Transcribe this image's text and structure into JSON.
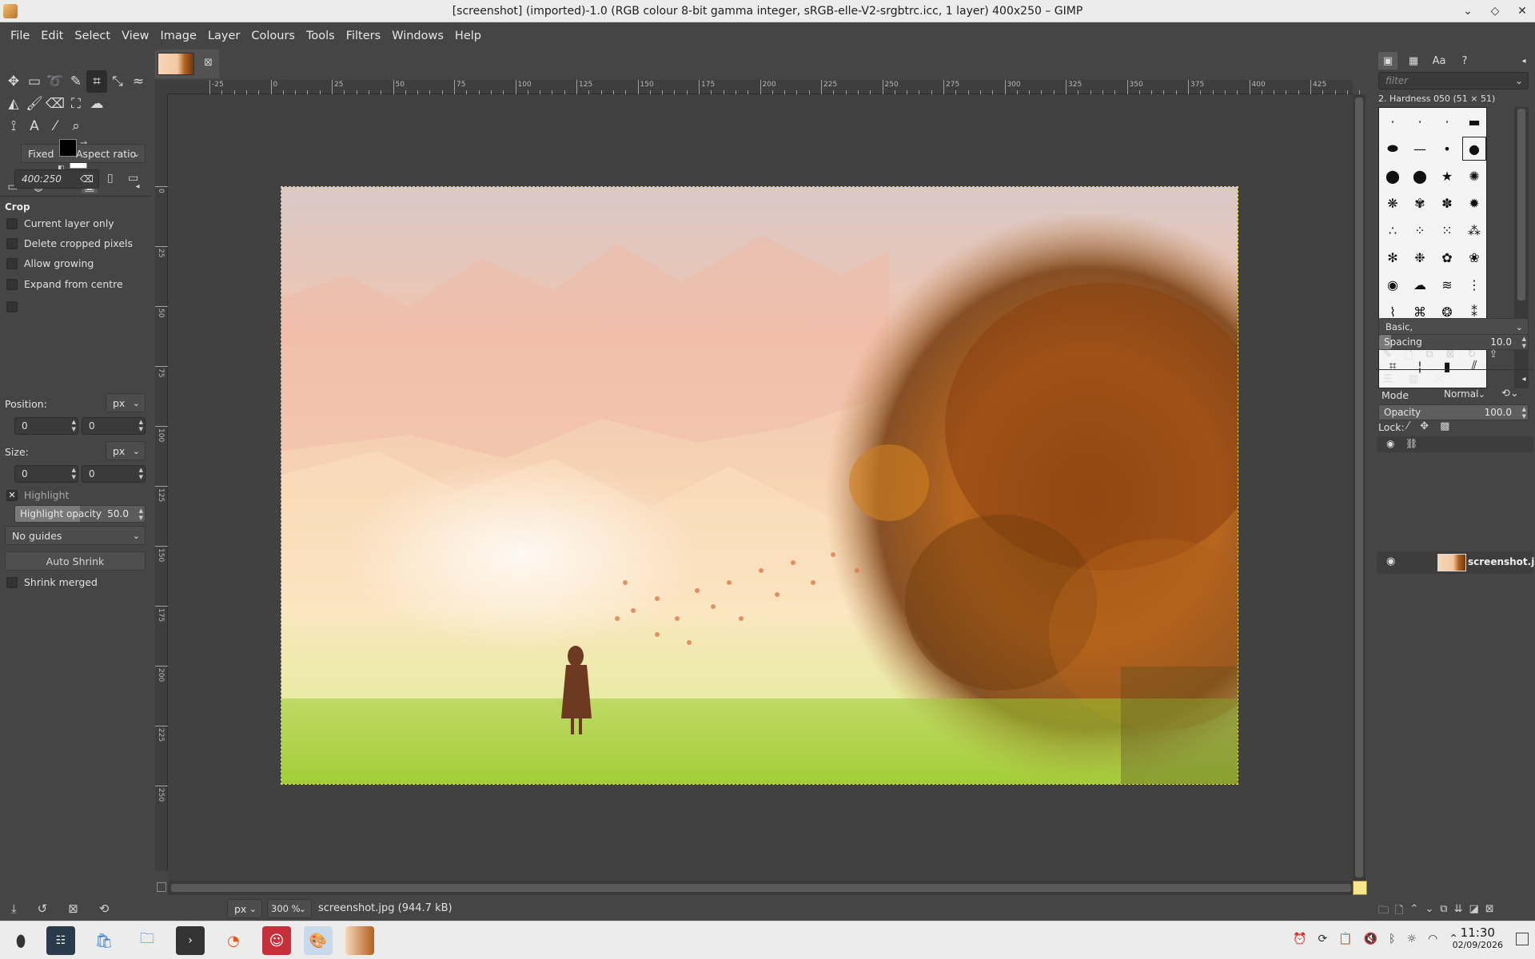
{
  "window": {
    "title": "[screenshot] (imported)-1.0 (RGB colour 8-bit gamma integer, sRGB-elle-V2-srgbtrc.icc, 1 layer) 400x250 – GIMP"
  },
  "menubar": {
    "items": [
      "File",
      "Edit",
      "Select",
      "View",
      "Image",
      "Layer",
      "Colours",
      "Tools",
      "Filters",
      "Windows",
      "Help"
    ]
  },
  "tool_options": {
    "title": "Crop",
    "checkboxes": [
      {
        "label": "Current layer only",
        "checked": false
      },
      {
        "label": "Delete cropped pixels",
        "checked": false
      },
      {
        "label": "Allow growing",
        "checked": false
      },
      {
        "label": "Expand from centre",
        "checked": false
      }
    ],
    "fixed_label": "Fixed",
    "fixed_mode": "Aspect ratio",
    "ratio_value": "400:250",
    "position_label": "Position:",
    "position_unit": "px",
    "position_x": "0",
    "position_y": "0",
    "size_label": "Size:",
    "size_unit": "px",
    "size_w": "0",
    "size_h": "0",
    "highlight_label": "Highlight",
    "highlight_opacity_label": "Highlight opacity",
    "highlight_opacity_value": "50.0",
    "highlight_opacity_fraction": 0.5,
    "guides": "No guides",
    "auto_shrink": "Auto Shrink",
    "shrink_merged": "Shrink merged"
  },
  "rulers": {
    "h_labels": [
      "-25",
      "0",
      "25",
      "50",
      "75",
      "100",
      "125",
      "150",
      "175",
      "200",
      "225",
      "250",
      "275",
      "300",
      "325",
      "350",
      "375",
      "400",
      "425"
    ],
    "v_labels": [
      "0",
      "25",
      "50",
      "75",
      "100",
      "125",
      "150",
      "175",
      "200",
      "225",
      "250"
    ]
  },
  "statusbar": {
    "unit": "px",
    "zoom": "300 %",
    "file_info": "screenshot.jpg (944.7 kB)"
  },
  "brushes": {
    "filter_placeholder": "filter",
    "selected_name": "2. Hardness 050 (51 × 51)",
    "preset": "Basic,",
    "spacing_label": "Spacing",
    "spacing_value": "10.0"
  },
  "layers": {
    "mode_label": "Mode",
    "mode_value": "Normal",
    "opacity_label": "Opacity",
    "opacity_value": "100.0",
    "lock_label": "Lock:",
    "layer_name": "screenshot.jp"
  },
  "taskbar": {
    "time": "11:30",
    "date": "02/09/2026"
  },
  "colors": {
    "fg": "#000000",
    "bg": "#ffffff",
    "selection_marching_ants": "#e8d34a",
    "ui_bg": "#454545"
  }
}
